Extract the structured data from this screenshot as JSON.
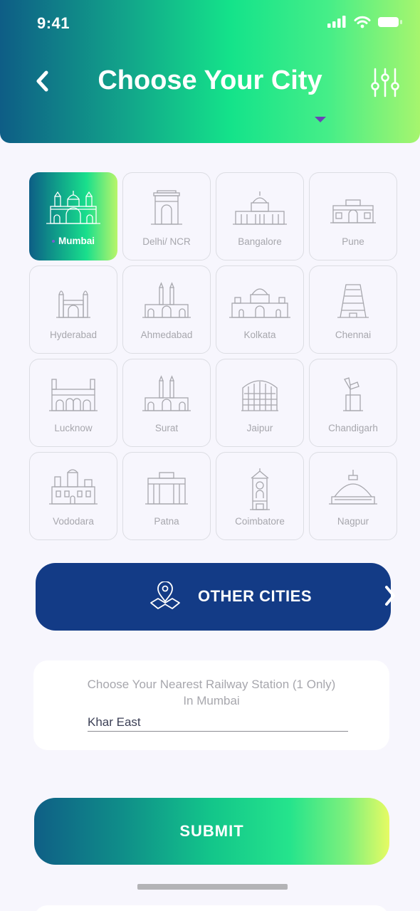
{
  "status": {
    "time": "9:41"
  },
  "header": {
    "title": "Choose Your City",
    "back_icon": "chevron-left-icon",
    "filter_icon": "sliders-icon",
    "gradient": [
      "#0e5d86",
      "#14e38a",
      "#a6f56e"
    ]
  },
  "cities": [
    {
      "label": "Mumbai",
      "icon": "mumbai-gateway-icon",
      "selected": true
    },
    {
      "label": "Delhi/ NCR",
      "icon": "india-gate-icon"
    },
    {
      "label": "Bangalore",
      "icon": "vidhana-soudha-icon"
    },
    {
      "label": "Pune",
      "icon": "shaniwar-wada-icon"
    },
    {
      "label": "Hyderabad",
      "icon": "charminar-icon"
    },
    {
      "label": "Ahmedabad",
      "icon": "mosque-icon"
    },
    {
      "label": "Kolkata",
      "icon": "victoria-memorial-icon"
    },
    {
      "label": "Chennai",
      "icon": "temple-gopuram-icon"
    },
    {
      "label": "Lucknow",
      "icon": "rumi-darwaza-icon"
    },
    {
      "label": "Surat",
      "icon": "mosque-icon"
    },
    {
      "label": "Jaipur",
      "icon": "hawa-mahal-icon"
    },
    {
      "label": "Chandigarh",
      "icon": "open-hand-monument-icon"
    },
    {
      "label": "Vododara",
      "icon": "palace-icon"
    },
    {
      "label": "Patna",
      "icon": "building-icon"
    },
    {
      "label": "Coimbatore",
      "icon": "clock-tower-icon"
    },
    {
      "label": "Nagpur",
      "icon": "stupa-icon"
    }
  ],
  "other_cities": {
    "label": "OTHER CITIES",
    "icon": "map-pin-icon",
    "color": "#133b86"
  },
  "station": {
    "question_line1": "Choose Your Nearest Railway Station (1 Only)",
    "question_line2": "In Mumbai",
    "value": "Khar East"
  },
  "submit": {
    "label": "SUBMIT"
  }
}
